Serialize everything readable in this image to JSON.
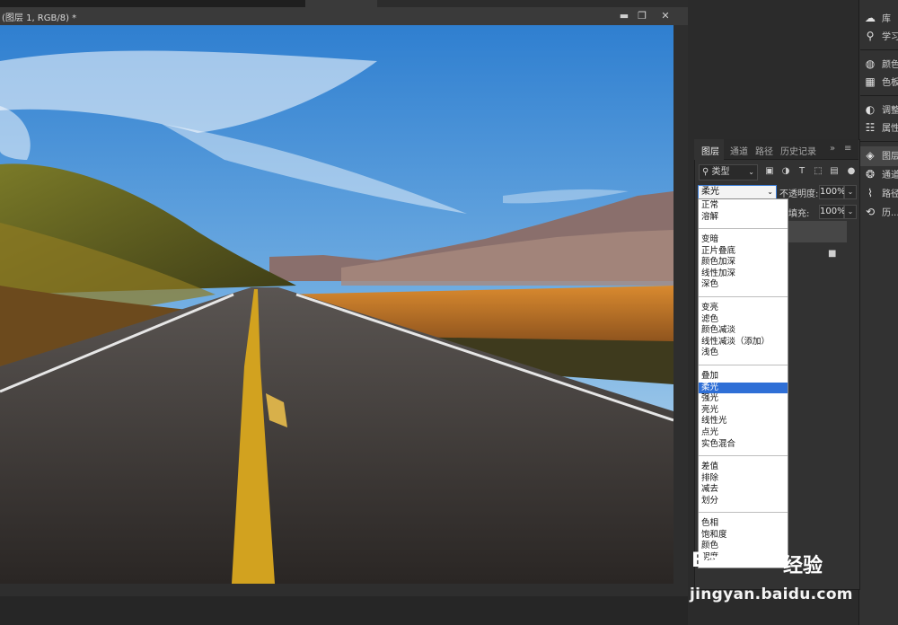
{
  "document": {
    "title": "(图层 1, RGB/8) *",
    "window_buttons": {
      "minimize": "▬",
      "restore": "❐",
      "close": "✕"
    }
  },
  "dock": {
    "items": [
      {
        "icon": "libraries-icon",
        "glyph": "☁",
        "label": "库"
      },
      {
        "icon": "learn-icon",
        "glyph": "💡",
        "label": "学习"
      },
      {
        "icon": "color-icon",
        "glyph": "◍",
        "label": "颜色"
      },
      {
        "icon": "swatches-icon",
        "glyph": "▦",
        "label": "色板"
      },
      {
        "icon": "adjustments-icon",
        "glyph": "◐",
        "label": "调整"
      },
      {
        "icon": "properties-icon",
        "glyph": "☷",
        "label": "属性"
      },
      {
        "icon": "layers-icon",
        "glyph": "◈",
        "label": "图层"
      },
      {
        "icon": "channels-icon",
        "glyph": "❂",
        "label": "通道"
      },
      {
        "icon": "paths-icon",
        "glyph": "⌇",
        "label": "路径"
      },
      {
        "icon": "history-icon",
        "glyph": "⟲",
        "label": "历..."
      }
    ]
  },
  "layers_panel": {
    "tabs": [
      "图层",
      "通道",
      "路径",
      "历史记录"
    ],
    "more": "»",
    "menu": "≡",
    "filter_label": "⚲ 类型",
    "blend_mode": "柔光",
    "opacity_label": "不透明度:",
    "opacity_value": "100%",
    "fill_label": "填充:",
    "fill_value": "100%",
    "lock_glyph": "🔒"
  },
  "blend_modes": {
    "groups": [
      [
        "正常",
        "溶解"
      ],
      [
        "变暗",
        "正片叠底",
        "颜色加深",
        "线性加深",
        "深色"
      ],
      [
        "变亮",
        "滤色",
        "颜色减淡",
        "线性减淡（添加）",
        "浅色"
      ],
      [
        "叠加",
        "柔光",
        "强光",
        "亮光",
        "线性光",
        "点光",
        "实色混合"
      ],
      [
        "差值",
        "排除",
        "减去",
        "划分"
      ],
      [
        "色相",
        "饱和度",
        "颜色",
        "明度"
      ]
    ],
    "selected": "柔光"
  },
  "watermark": {
    "logo": "Bai",
    "logo2": "经验",
    "url": "jingyan.baidu.com"
  },
  "colors": {
    "selection": "#2f6fd6",
    "panel_bg": "#323232",
    "app_bg": "#262626"
  }
}
